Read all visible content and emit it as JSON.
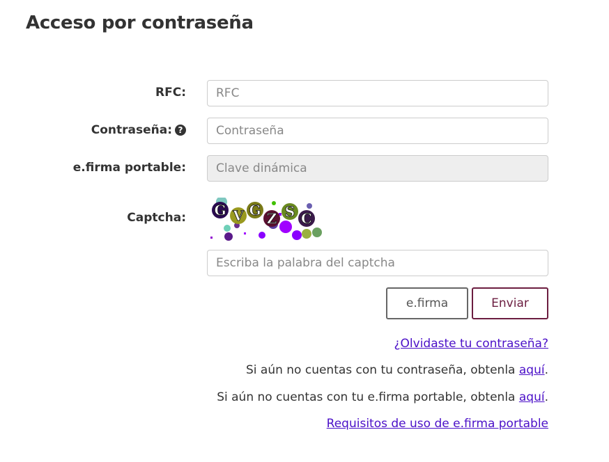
{
  "page": {
    "title": "Acceso por contraseña"
  },
  "form": {
    "rfc_label": "RFC:",
    "rfc_placeholder": "RFC",
    "password_label": "Contraseña:",
    "password_help_icon": "question-circle-icon",
    "password_placeholder": "Contraseña",
    "efirma_label": "e.firma portable:",
    "efirma_placeholder": "Clave dinámica",
    "captcha_label": "Captcha:",
    "captcha_text": "GVGZSC",
    "captcha_placeholder": "Escriba la palabra del captcha"
  },
  "buttons": {
    "efirma": "e.firma",
    "enviar": "Enviar"
  },
  "links": {
    "forgot_password": "¿Olvidaste tu contraseña?",
    "no_password_text": "Si aún no cuentas con tu contraseña, obtenla ",
    "no_password_link": "aquí",
    "no_efirma_text": "Si aún no cuentas con tu e.firma portable, obtenla ",
    "no_efirma_link": "aquí",
    "period": ".",
    "requirements": "Requisitos de uso de e.firma portable"
  },
  "colors": {
    "primary": "#6b1d40",
    "link": "#4b10c8",
    "text": "#333333"
  }
}
